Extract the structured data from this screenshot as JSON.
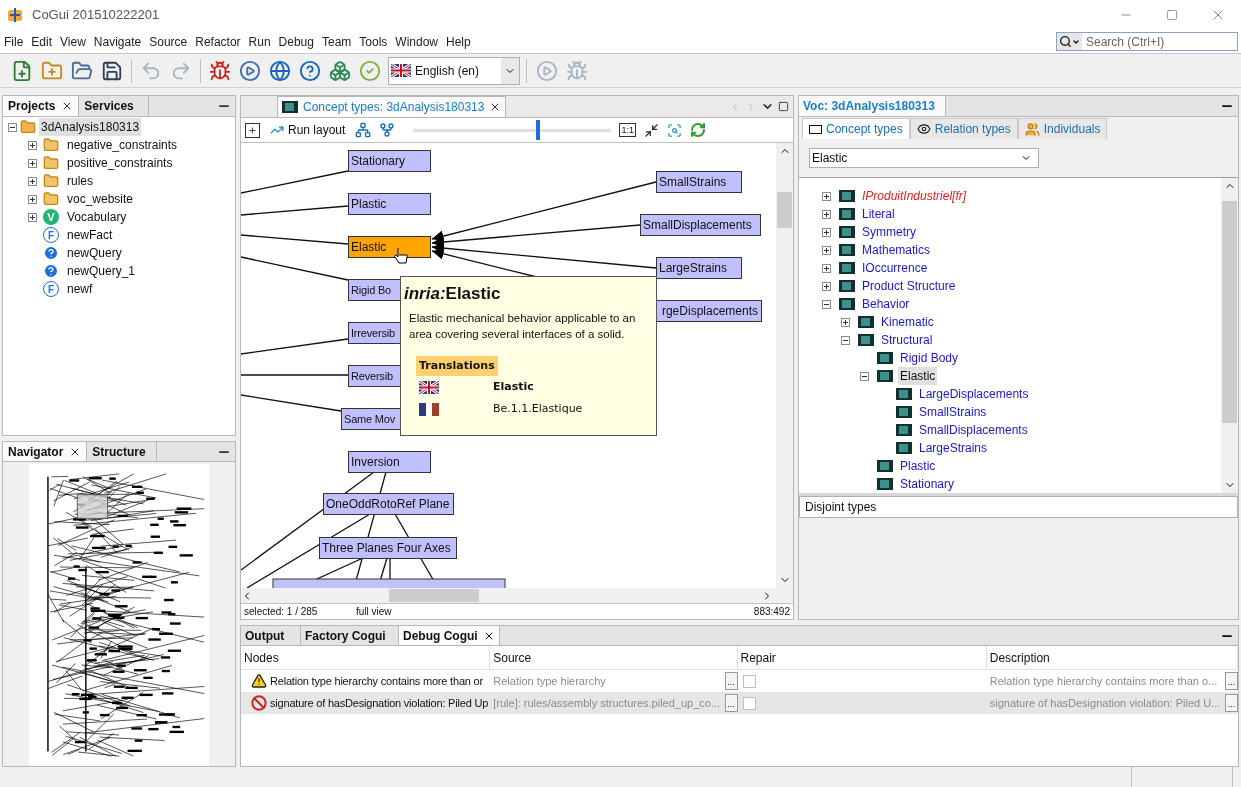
{
  "window": {
    "title": "CoGui 201510222201"
  },
  "menu": [
    "File",
    "Edit",
    "View",
    "Navigate",
    "Source",
    "Refactor",
    "Run",
    "Debug",
    "Team",
    "Tools",
    "Window",
    "Help"
  ],
  "search": {
    "placeholder": "Search (Ctrl+I)"
  },
  "toolbar": [
    {
      "kind": "new-file",
      "disabled": false
    },
    {
      "kind": "new-folder",
      "disabled": false
    },
    {
      "kind": "open",
      "disabled": false
    },
    {
      "kind": "save",
      "disabled": false
    },
    {
      "kind": "undo",
      "disabled": true
    },
    {
      "kind": "redo",
      "disabled": true
    },
    {
      "kind": "bug",
      "disabled": false
    },
    {
      "kind": "run",
      "disabled": false
    },
    {
      "kind": "web",
      "disabled": false
    },
    {
      "kind": "help",
      "disabled": false
    },
    {
      "kind": "blocks",
      "disabled": false
    },
    {
      "kind": "validate",
      "disabled": false
    }
  ],
  "language": {
    "value": "English (en)"
  },
  "toolbar_end": [
    {
      "kind": "run",
      "disabled": true
    },
    {
      "kind": "bug",
      "disabled": true
    }
  ],
  "projects_panel": {
    "tabs": [
      {
        "label": "Projects",
        "selected": true
      },
      {
        "label": "Services",
        "selected": false
      }
    ],
    "root": {
      "label": "3dAnalysis180313",
      "selected": true,
      "expanded": true
    },
    "items": [
      {
        "label": "negative_constraints",
        "kind": "folder",
        "expanded": false,
        "selected": false
      },
      {
        "label": "positive_constraints",
        "kind": "folder",
        "expanded": false,
        "selected": false
      },
      {
        "label": "rules",
        "kind": "folder",
        "expanded": false,
        "selected": false
      },
      {
        "label": "voc_website",
        "kind": "folder",
        "expanded": false,
        "selected": false
      },
      {
        "label": "Vocabulary",
        "kind": "vocabulary",
        "badge": "V",
        "expanded": false,
        "selected": false
      },
      {
        "label": "newFact",
        "kind": "fact",
        "badge": "F",
        "selected": false
      },
      {
        "label": "newQuery",
        "kind": "query",
        "selected": false
      },
      {
        "label": "newQuery_1",
        "kind": "query",
        "selected": false
      },
      {
        "label": "newf",
        "kind": "fact",
        "badge": "F",
        "selected": false
      }
    ]
  },
  "navigator_panel": {
    "tabs": [
      {
        "label": "Navigator",
        "selected": true
      },
      {
        "label": "Structure",
        "selected": false
      }
    ]
  },
  "editor": {
    "tab": {
      "label": "Concept types: 3dAnalysis180313",
      "selected": true
    },
    "run_layout": "Run layout",
    "zoom_slider": {
      "level": 0.63
    },
    "actual_size": "1:1",
    "nodes": [
      {
        "label": "Stationary",
        "selected": false
      },
      {
        "label": "Plastic",
        "selected": false
      },
      {
        "label": "Elastic",
        "selected": true
      },
      {
        "label": "Rigid Bo",
        "selected": false
      },
      {
        "label": "Irreversib",
        "selected": false
      },
      {
        "label": "Reversib",
        "selected": false
      },
      {
        "label": "Same Mov",
        "selected": false
      },
      {
        "label": "Inversion",
        "selected": false
      },
      {
        "label": "OneOddRotoRef Plane",
        "selected": false
      },
      {
        "label": "Three Planes Four Axes",
        "selected": false
      },
      {
        "label": "SmallStrains",
        "selected": false
      },
      {
        "label": "SmallDisplacements",
        "selected": false
      },
      {
        "label": "LargeStrains",
        "selected": false
      },
      {
        "label": "rgeDisplacements",
        "selected": false
      }
    ],
    "tooltip": {
      "prefix": "inria:",
      "title": "Elastic",
      "description": "Elastic mechanical behavior applicable to an area covering several interfaces of a solid.",
      "heading": "Translations",
      "translations": [
        {
          "kind": "uk",
          "text": "Elastic",
          "current": true
        },
        {
          "kind": "fr",
          "text": "Be.1.1.Elastique",
          "current": false
        }
      ]
    },
    "status": {
      "selection": "selected: 1 / 285",
      "view": "full view",
      "position": "883:492"
    }
  },
  "vocabulary_panel": {
    "title": "Voc: 3dAnalysis180313",
    "tabs": [
      {
        "label": "Concept types",
        "kind": "concept",
        "selected": true
      },
      {
        "label": "Relation types",
        "kind": "relation",
        "selected": false
      },
      {
        "label": "Individuals",
        "kind": "individual",
        "selected": false
      }
    ],
    "filter": {
      "value": "Elastic"
    },
    "tree": [
      {
        "label": "IProduitIndustriel[fr]",
        "kind": "untranslated",
        "expanded": false,
        "selected": false
      },
      {
        "label": "Literal",
        "kind": "concept",
        "expanded": false,
        "selected": false
      },
      {
        "label": "Symmetry",
        "kind": "concept",
        "expanded": false,
        "selected": false
      },
      {
        "label": "Mathematics",
        "kind": "concept",
        "expanded": false,
        "selected": false
      },
      {
        "label": "IOccurrence",
        "kind": "concept",
        "expanded": false,
        "selected": false
      },
      {
        "label": "Product Structure",
        "kind": "concept",
        "expanded": false,
        "selected": false
      },
      {
        "label": "Behavior",
        "kind": "concept",
        "expanded": true,
        "selected": false,
        "children": [
          {
            "label": "Kinematic",
            "kind": "concept",
            "expanded": false,
            "selected": false
          },
          {
            "label": "Structural",
            "kind": "concept",
            "expanded": true,
            "selected": false,
            "children": [
              {
                "label": "Rigid Body",
                "kind": "concept",
                "selected": false
              },
              {
                "label": "Elastic",
                "kind": "concept",
                "expanded": true,
                "selected": true,
                "children": [
                  {
                    "label": "LargeDisplacements",
                    "kind": "concept",
                    "selected": false
                  },
                  {
                    "label": "SmallStrains",
                    "kind": "concept",
                    "selected": false
                  },
                  {
                    "label": "SmallDisplacements",
                    "kind": "concept",
                    "selected": false
                  },
                  {
                    "label": "LargeStrains",
                    "kind": "concept",
                    "selected": false
                  }
                ]
              },
              {
                "label": "Plastic",
                "kind": "concept",
                "selected": false
              },
              {
                "label": "Stationary",
                "kind": "concept",
                "selected": false
              }
            ]
          }
        ]
      }
    ],
    "disjoint": {
      "label": "Disjoint types"
    }
  },
  "debug_panel": {
    "tabs": [
      {
        "label": "Output",
        "selected": false
      },
      {
        "label": "Factory Cogui",
        "selected": false
      },
      {
        "label": "Debug Cogui",
        "selected": true
      }
    ],
    "columns": [
      "Nodes",
      "Source",
      "Repair",
      "Description"
    ],
    "rows": [
      {
        "kind": "warning",
        "nodes": "Relation type hierarchy contains more than or",
        "source": "Relation type hierarchy",
        "repair": false,
        "description": "Relation type hierarchy contains more than o...",
        "source_button": "...",
        "description_button": "...",
        "selected": false
      },
      {
        "kind": "error",
        "nodes": "signature of hasDesignation violation: Piled Up",
        "source": "[rule]: rules/assembly structures.piled_up_co...",
        "repair": false,
        "description": "signature of hasDesignation violation: Piled U...",
        "source_button": "...",
        "description_button": "...",
        "selected": true
      }
    ]
  }
}
